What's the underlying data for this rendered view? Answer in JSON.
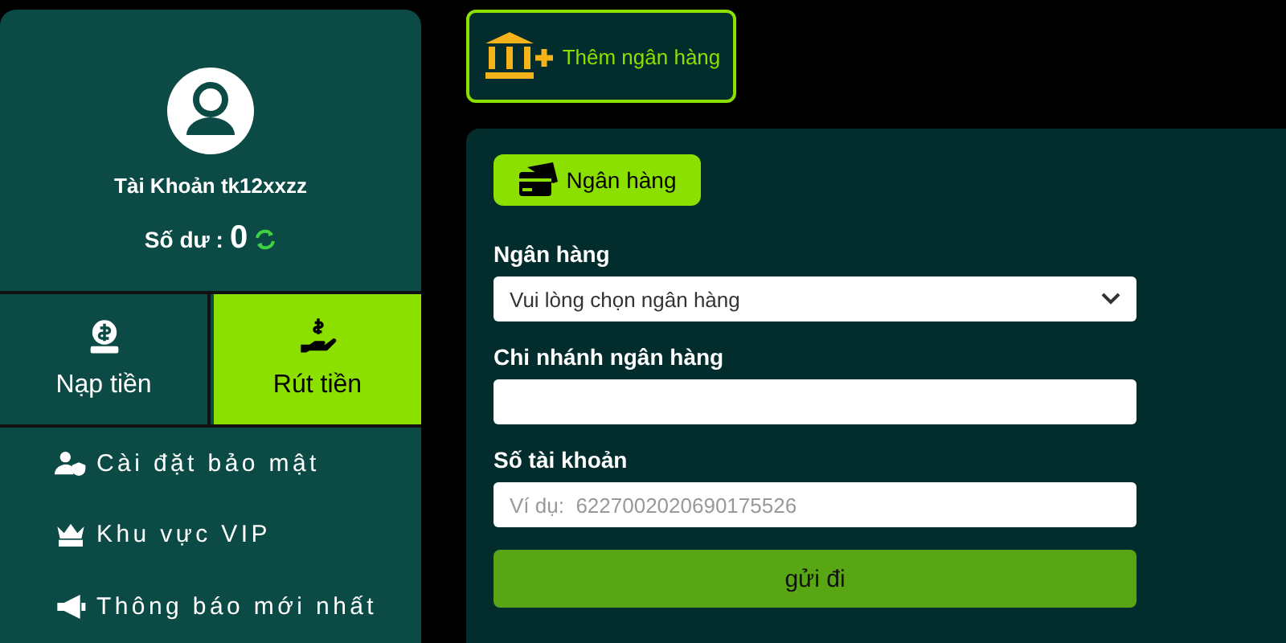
{
  "profile": {
    "account": "Tài Khoản tk12xxzz",
    "balance_label": "Số dư :",
    "balance": "0"
  },
  "actions": [
    {
      "kind": "deposit",
      "label": "Nạp tiền",
      "selected": false
    },
    {
      "kind": "withdraw",
      "label": "Rút tiền",
      "selected": true
    }
  ],
  "menu": [
    {
      "kind": "security",
      "label": "Cài đặt bảo mật"
    },
    {
      "kind": "vip",
      "label": "Khu vực VIP"
    },
    {
      "kind": "notice",
      "label": "Thông báo mới nhất"
    }
  ],
  "add_bank_button": "Thêm ngân hàng",
  "tabs": [
    {
      "label": "Ngân hàng",
      "selected": true
    }
  ],
  "form": {
    "fields": [
      {
        "kind": "select",
        "label": "Ngân hàng",
        "value": "Vui lòng chọn ngân hàng"
      },
      {
        "kind": "text",
        "label": "Chi nhánh ngân hàng"
      },
      {
        "kind": "text",
        "label": "Số tài khoản",
        "placeholder": "Ví dụ:  6227002020690175526"
      }
    ],
    "submit": "gửi đi"
  }
}
